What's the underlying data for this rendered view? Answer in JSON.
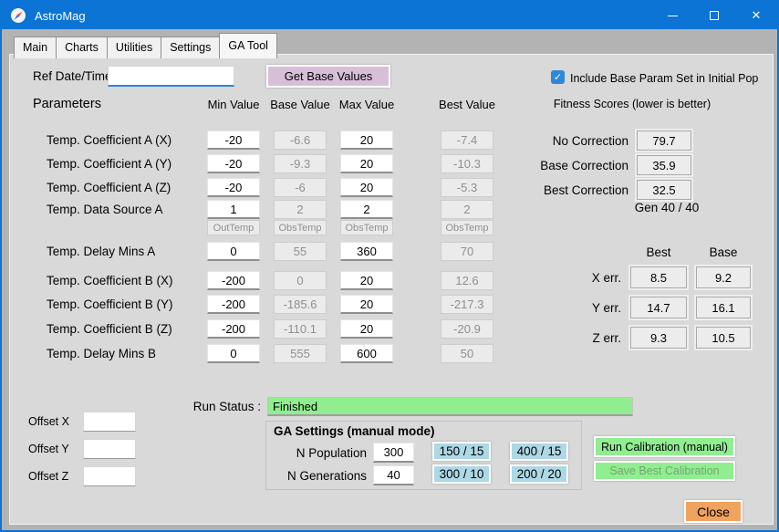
{
  "colors": {
    "titlebar": "#0b74d4",
    "checkbox_blue": "#2e87d8",
    "accent_purple": "#d8bfd8",
    "status_green": "#90ee90",
    "preset_blue": "#add8e6",
    "close_orange": "#f0a35e"
  },
  "icons": {
    "close_glyph": "✕",
    "check_glyph": "✓"
  },
  "window": {
    "title": "AstroMag"
  },
  "tabs": [
    {
      "label": "Main",
      "active": false
    },
    {
      "label": "Charts",
      "active": false
    },
    {
      "label": "Utilities",
      "active": false
    },
    {
      "label": "Settings",
      "active": false
    },
    {
      "label": "GA Tool",
      "active": true
    }
  ],
  "header": {
    "ref_label": "Ref Date/Time",
    "ref_value": "",
    "get_base_button": "Get Base Values",
    "include_checkbox_label": "Include Base Param Set in Initial Pop",
    "include_checkbox_checked": true
  },
  "columns": {
    "params_label": "Parameters",
    "min": "Min Value",
    "base": "Base Value",
    "max": "Max Value",
    "best": "Best Value",
    "fitness_header": "Fitness Scores (lower is better)"
  },
  "parameters": [
    {
      "label": "Temp. Coefficient A (X)",
      "type": "values",
      "min": "-20",
      "base": "-6.6",
      "max": "20",
      "best": "-7.4"
    },
    {
      "label": "Temp. Coefficient A (Y)",
      "type": "values",
      "min": "-20",
      "base": "-9.3",
      "max": "20",
      "best": "-10.3"
    },
    {
      "label": "Temp. Coefficient A (Z)",
      "type": "values",
      "min": "-20",
      "base": "-6",
      "max": "20",
      "best": "-5.3"
    },
    {
      "label": "Temp. Data Source A",
      "type": "values",
      "min": "1",
      "base": "2",
      "max": "2",
      "best": "2"
    },
    {
      "label": "",
      "type": "names",
      "min": "OutTemp",
      "base": "ObsTemp",
      "max": "ObsTemp",
      "best": "ObsTemp"
    },
    {
      "label": "Temp. Delay Mins A",
      "type": "values",
      "min": "0",
      "base": "55",
      "max": "360",
      "best": "70"
    },
    {
      "label": "Temp. Coefficient B (X)",
      "type": "values",
      "min": "-200",
      "base": "0",
      "max": "20",
      "best": "12.6"
    },
    {
      "label": "Temp. Coefficient B (Y)",
      "type": "values",
      "min": "-200",
      "base": "-185.6",
      "max": "20",
      "best": "-217.3"
    },
    {
      "label": "Temp. Coefficient B (Z)",
      "type": "values",
      "min": "-200",
      "base": "-110.1",
      "max": "20",
      "best": "-20.9"
    },
    {
      "label": "Temp. Delay Mins B",
      "type": "values",
      "min": "0",
      "base": "555",
      "max": "600",
      "best": "50"
    }
  ],
  "fitness": {
    "rows": [
      {
        "label": "No Correction",
        "value": "79.7"
      },
      {
        "label": "Base Correction",
        "value": "35.9"
      },
      {
        "label": "Best Correction",
        "value": "32.5"
      }
    ]
  },
  "generation": "Gen 40 / 40",
  "errors": {
    "col_best": "Best",
    "col_base": "Base",
    "rows": [
      {
        "label": "X err.",
        "best": "8.5",
        "base": "9.2"
      },
      {
        "label": "Y err.",
        "best": "14.7",
        "base": "16.1"
      },
      {
        "label": "Z err.",
        "best": "9.3",
        "base": "10.5"
      }
    ]
  },
  "run_status": {
    "label": "Run Status :",
    "value": "Finished"
  },
  "offsets": [
    {
      "label": "Offset X",
      "value": ""
    },
    {
      "label": "Offset Y",
      "value": ""
    },
    {
      "label": "Offset Z",
      "value": ""
    }
  ],
  "ga_settings": {
    "title": "GA Settings (manual mode)",
    "n_population_label": "N Population",
    "n_population": "300",
    "n_generations_label": "N Generations",
    "n_generations": "40",
    "presets": [
      "150 / 15",
      "400 / 15",
      "300 / 10",
      "200 / 20"
    ]
  },
  "actions": {
    "run_calibration": "Run Calibration (manual)",
    "save_best": "Save Best Calibration",
    "close": "Close"
  }
}
